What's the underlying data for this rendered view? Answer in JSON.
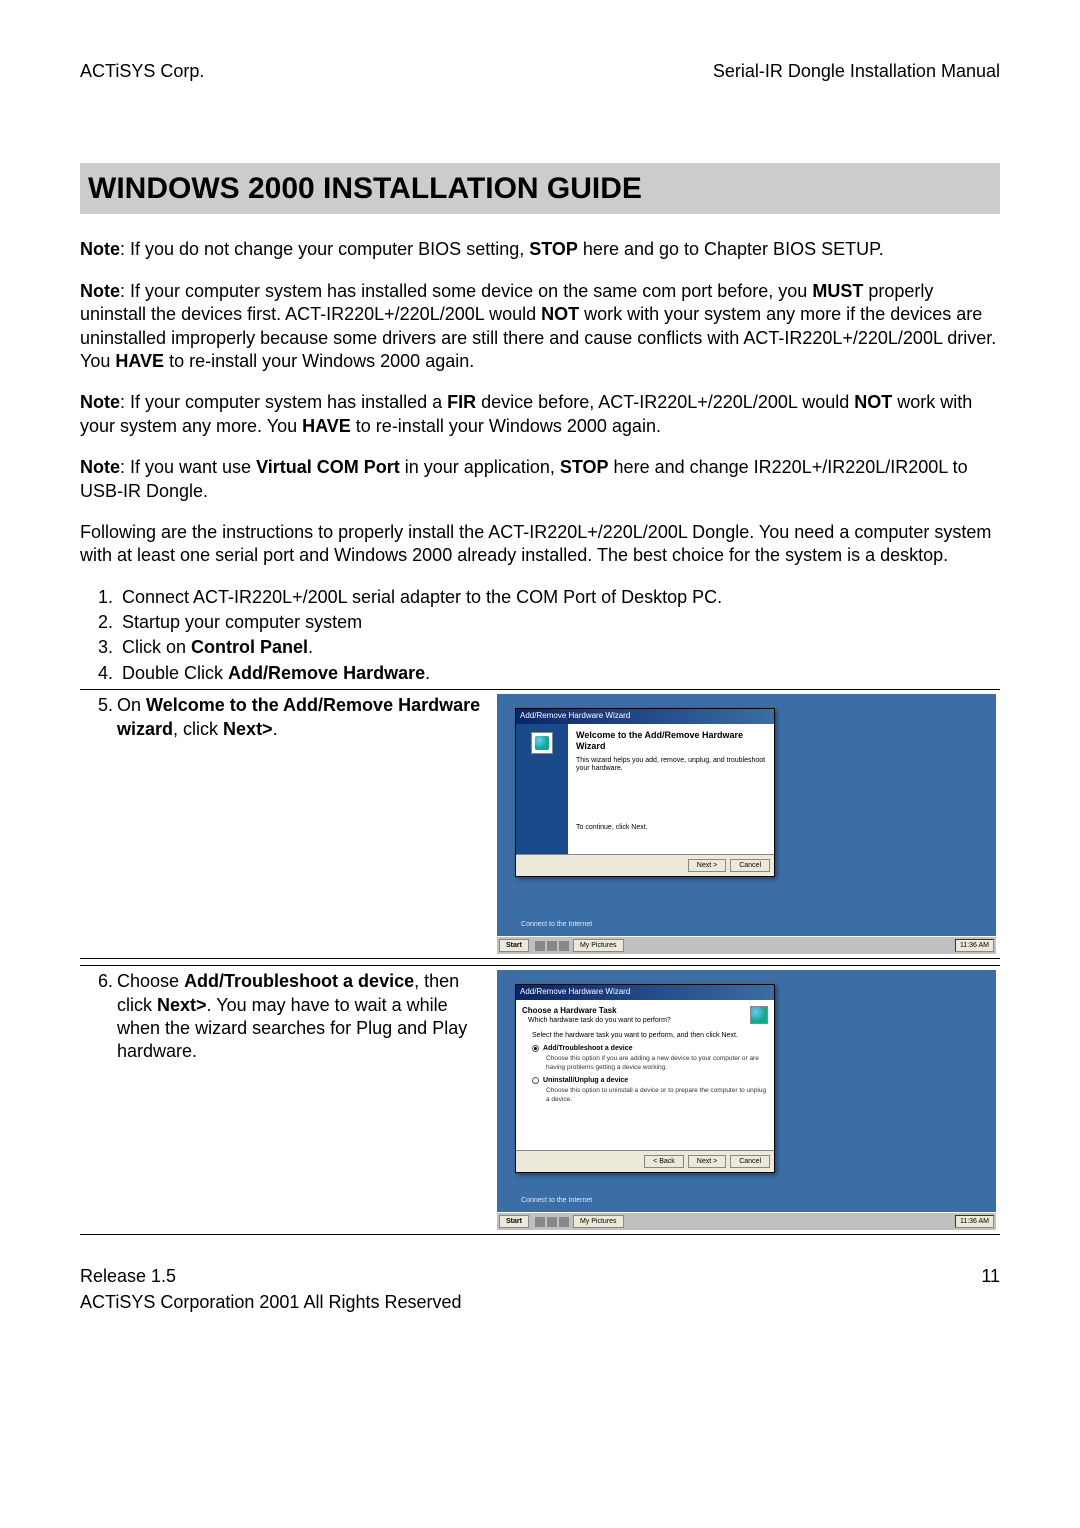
{
  "header": {
    "left": "ACTiSYS Corp.",
    "right": "Serial-IR Dongle Installation Manual"
  },
  "section_title": "WINDOWS 2000 INSTALLATION GUIDE",
  "notes": {
    "n1_prefix": "Note",
    "n1_text": ":  If you do not change your computer BIOS setting, ",
    "n1_bold1": "STOP",
    "n1_text2": " here and go to Chapter BIOS SETUP.",
    "n2_prefix": "Note",
    "n2_text": ":  If your computer system has installed some device on the same com port before, you ",
    "n2_bold1": "MUST",
    "n2_text2": " properly uninstall the devices first. ACT-IR220L+/220L/200L would ",
    "n2_bold2": "NOT",
    "n2_text3": " work with your system any more if the devices are uninstalled improperly because some drivers are still there and cause conflicts with ACT-IR220L+/220L/200L driver. You ",
    "n2_bold3": "HAVE",
    "n2_text4": " to re-install your Windows 2000 again.",
    "n3_prefix": "Note",
    "n3_text": ":  If your computer system has installed a ",
    "n3_bold1": "FIR",
    "n3_text2": " device before, ACT-IR220L+/220L/200L would ",
    "n3_bold2": "NOT",
    "n3_text3": " work with your system any more. You ",
    "n3_bold3": "HAVE",
    "n3_text4": " to re-install your Windows 2000 again.",
    "n4_prefix": "Note",
    "n4_text": ": If you want use ",
    "n4_bold1": "Virtual COM Port",
    "n4_text2": " in your application, ",
    "n4_bold2": "STOP",
    "n4_text3": " here and change IR220L+/IR220L/IR200L to USB-IR Dongle."
  },
  "intro": "Following are the instructions to properly install the ACT-IR220L+/220L/200L Dongle. You need a computer system with at least one serial port and Windows 2000 already installed. The best choice for the system is a desktop.",
  "steps": {
    "s1": "Connect ACT-IR220L+/200L serial adapter to the COM Port of Desktop PC.",
    "s2": "Startup your computer system",
    "s3a": "Click on ",
    "s3b": "Control Panel",
    "s3c": ".",
    "s4a": "Double Click ",
    "s4b": "Add/Remove Hardware",
    "s4c": ".",
    "s5_num": "5.",
    "s5a": "On ",
    "s5b": "Welcome to the Add/Remove Hardware wizard",
    "s5c": ", click ",
    "s5d": "Next>",
    "s5e": ".",
    "s6_num": "6.",
    "s6a": "Choose ",
    "s6b": "Add/Troubleshoot a device",
    "s6c": ", then click ",
    "s6d": "Next>",
    "s6e": ". You may have to wait a while when the wizard searches for Plug and Play hardware."
  },
  "wizard1": {
    "title": "Add/Remove Hardware Wizard",
    "heading": "Welcome to the Add/Remove Hardware Wizard",
    "desc": "This wizard helps you add, remove, unplug, and troubleshoot your hardware.",
    "continue": "To continue, click Next.",
    "btn_next": "Next >",
    "btn_cancel": "Cancel"
  },
  "wizard2": {
    "title": "Add/Remove Hardware Wizard",
    "heading": "Choose a Hardware Task",
    "subheading": "Which hardware task do you want to perform?",
    "prompt": "Select the hardware task you want to perform, and then click Next.",
    "opt1": "Add/Troubleshoot a device",
    "opt1_desc": "Choose this option if you are adding a new device to your computer or are having problems getting a device working.",
    "opt2": "Uninstall/Unplug a device",
    "opt2_desc": "Choose this option to uninstall a device or to prepare the computer to unplug a device.",
    "btn_back": "< Back",
    "btn_next": "Next >",
    "btn_cancel": "Cancel"
  },
  "taskbar": {
    "start": "Start",
    "task1": "My Pictures",
    "clock": "11:36 AM",
    "desktop_label": "Connect to\nthe Internet"
  },
  "footer": {
    "release": "Release 1.5",
    "page": "11",
    "copyright": "ACTiSYS Corporation   2001    All Rights Reserved"
  }
}
